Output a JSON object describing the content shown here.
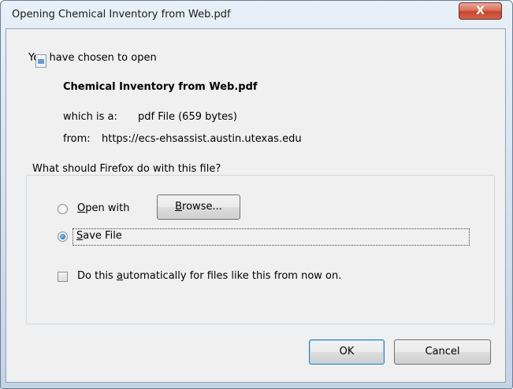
{
  "window": {
    "title": "Opening Chemical Inventory from Web.pdf",
    "close_label": "X"
  },
  "dialog": {
    "intro": "You have chosen to open",
    "file_name": "Chemical Inventory from Web.pdf",
    "type_label": "which is a:",
    "type_value": "pdf File (659 bytes)",
    "from_label": "from:",
    "from_value": "https://ecs-ehsassist.austin.utexas.edu"
  },
  "group": {
    "label": "What should Firefox do with this file?",
    "open_with": {
      "mnemonic": "O",
      "rest": "pen with",
      "selected": false
    },
    "browse": {
      "mnemonic": "B",
      "rest": "rowse..."
    },
    "save_file": {
      "mnemonic": "S",
      "rest": "ave File",
      "selected": true
    },
    "auto": {
      "before": "Do this ",
      "mnemonic": "a",
      "after": "utomatically for files like this from now on.",
      "checked": false
    }
  },
  "buttons": {
    "ok": "OK",
    "cancel": "Cancel"
  }
}
